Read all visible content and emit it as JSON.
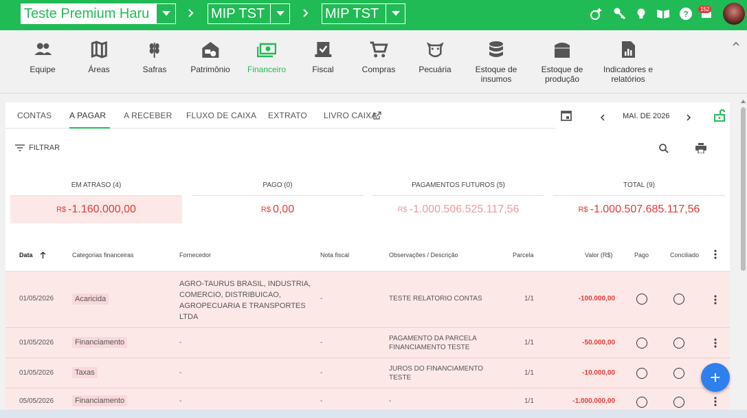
{
  "topbar": {
    "account": "Teste Premium Haru",
    "farm": "MIP TST",
    "season": "MIP TST",
    "notification_count": "152",
    "icons": [
      "pest-icon",
      "key-icon",
      "lightbulb-icon",
      "map-book-icon",
      "help-icon",
      "notifications-icon"
    ]
  },
  "modules": [
    {
      "label": "Equipe",
      "icon": "team-icon"
    },
    {
      "label": "Áreas",
      "icon": "map-icon"
    },
    {
      "label": "Safras",
      "icon": "wheat-icon"
    },
    {
      "label": "Patrimônio",
      "icon": "barn-tractor-icon"
    },
    {
      "label": "Financeiro",
      "icon": "money-icon",
      "active": true
    },
    {
      "label": "Fiscal",
      "icon": "fiscal-icon"
    },
    {
      "label": "Compras",
      "icon": "cart-icon"
    },
    {
      "label": "Pecuária",
      "icon": "cow-icon"
    },
    {
      "label": "Estoque de insumos",
      "icon": "database-icon"
    },
    {
      "label": "Estoque de produção",
      "icon": "silo-icon"
    },
    {
      "label": "Indicadores e relatórios",
      "icon": "report-icon"
    }
  ],
  "tabs": [
    "CONTAS",
    "A PAGAR",
    "A RECEBER",
    "FLUXO DE CAIXA",
    "EXTRATO",
    "LIVRO CAIXA"
  ],
  "active_tab": "A PAGAR",
  "month": "MAI. DE 2026",
  "filter_label": "FILTRAR",
  "summary": [
    {
      "label": "EM ATRASO (4)",
      "currency": "R$",
      "value": "-1.160.000,00"
    },
    {
      "label": "PAGO (0)",
      "currency": "R$",
      "value": "0,00"
    },
    {
      "label": "PAGAMENTOS FUTUROS (5)",
      "currency": "R$",
      "value": "-1.000.506.525.117,56"
    },
    {
      "label": "TOTAL (9)",
      "currency": "R$",
      "value": "-1.000.507.685.117,56"
    }
  ],
  "columns": {
    "date": "Data",
    "category": "Categorias financeiras",
    "supplier": "Fornecedor",
    "invoice": "Nota fiscal",
    "notes": "Observações / Descrição",
    "installment": "Parcela",
    "value": "Valor (R$)",
    "paid": "Pago",
    "reconciled": "Conciliado"
  },
  "rows": [
    {
      "date": "01/05/2026",
      "category": "Acaricida",
      "supplier": "AGRO-TAURUS BRASIL, INDUSTRIA, COMERCIO, DISTRIBUICAO, AGROPECUARIA E TRANSPORTES LTDA",
      "invoice": "-",
      "notes": "TESTE RELATORIO CONTAS",
      "installment": "1/1",
      "value": "-100.000,00"
    },
    {
      "date": "01/05/2026",
      "category": "Financiamento",
      "supplier": "-",
      "invoice": "-",
      "notes": "PAGAMENTO DA PARCELA FINANCIAMENTO TESTE",
      "installment": "1/1",
      "value": "-50.000,00"
    },
    {
      "date": "01/05/2026",
      "category": "Taxas",
      "supplier": "-",
      "invoice": "-",
      "notes": "JUROS DO FINANCIAMENTO TESTE",
      "installment": "1/1",
      "value": "-10.000,00"
    },
    {
      "date": "05/05/2026",
      "category": "Financiamento",
      "supplier": "-",
      "invoice": "-",
      "notes": "-",
      "installment": "1/1",
      "value": "-1.000.000,00"
    }
  ],
  "fab_label": "+"
}
